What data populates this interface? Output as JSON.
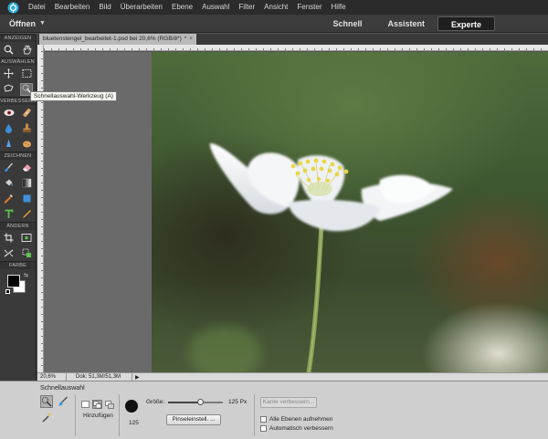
{
  "menu": {
    "logo": "photoshop-elements-logo",
    "items": [
      "Datei",
      "Bearbeiten",
      "Bild",
      "Überarbeiten",
      "Ebene",
      "Auswahl",
      "Filter",
      "Ansicht",
      "Fenster",
      "Hilfe"
    ]
  },
  "modebar": {
    "open_label": "Öffnen",
    "tabs": [
      "Schnell",
      "Assistent",
      "Experte"
    ],
    "active_tab": "Experte"
  },
  "toolbox": {
    "sections": {
      "view": "ANZEIGEN",
      "select": "AUSWÄHLEN",
      "enhance": "VERBESSERN",
      "draw": "ZEICHNEN",
      "modify": "ÄNDERN",
      "color": "FARBE"
    },
    "icons": {
      "view": [
        "zoom-icon",
        "hand-icon"
      ],
      "select": [
        "move-icon",
        "marquee-icon",
        "lasso-icon",
        "quick-selection-icon"
      ],
      "enhance": [
        "red-eye-icon",
        "healing-brush-icon",
        "blur-icon",
        "clone-stamp-icon",
        "sharpen-icon",
        "sponge-icon"
      ],
      "draw": [
        "brush-icon",
        "eraser-icon",
        "paint-bucket-icon",
        "gradient-icon",
        "eyedropper-icon",
        "shape-icon",
        "text-icon",
        "pencil-icon"
      ],
      "modify": [
        "crop-icon",
        "recompose-icon",
        "straighten-icon",
        "content-aware-move-icon"
      ]
    },
    "foreground_color": "#000000",
    "background_color": "#ffffff"
  },
  "tooltip": "Schnellauswahl-Werkzeug (A)",
  "document": {
    "tab_title": "bluetenstengel_bearbeitet-1.psd bei 20,6% (RGB/8*)",
    "modified_mark": "*",
    "close_glyph": "×"
  },
  "status": {
    "zoom": "20,6%",
    "doc_info": "Dok: 51,3M/51,3M",
    "arrow": "▶"
  },
  "options": {
    "title": "Schnellauswahl",
    "tool_icons": [
      "quick-selection-icon",
      "selection-brush-icon",
      "magic-wand-icon"
    ],
    "mode_icons": [
      "new-selection-icon",
      "add-selection-icon",
      "subtract-selection-icon"
    ],
    "mode_label": "Hinzufügen",
    "brush_size_value": "125",
    "size_label": "Größe:",
    "size_value": "125 Px",
    "size_fraction": 0.58,
    "brush_settings_button": "Pinseleinstell. ...",
    "refine_edge_button": "Kante verbessern...",
    "sample_all_layers": "Alle Ebenen aufnehmen",
    "auto_enhance": "Automatisch verbessern"
  }
}
